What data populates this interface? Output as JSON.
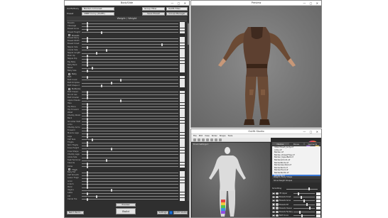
{
  "bodyslide": {
    "title": "BodySlide",
    "outfit_label": "Outfit/Body",
    "outfit_value": "Barden Armorset",
    "preset_label": "Preset",
    "preset_value": "CBBE Curvy (Outfit)",
    "group_filter": "Group Filter",
    "outfit_filter": "Outfit Filter",
    "save_preset": "Save Preset",
    "group_manager": "Group Manager",
    "header": "Weight / Weight",
    "categories": [
      {
        "label": "Breasts",
        "row": 4
      },
      {
        "label": "Belly",
        "row": 17
      },
      {
        "label": "Buttocks",
        "row": 22
      },
      {
        "label": "Thigh",
        "row": 49
      }
    ],
    "sliders": [
      {
        "name": "Breasts",
        "pos": 0.05
      },
      {
        "name": "Cleavage",
        "pos": 0.05
      },
      {
        "name": "Breast Gone",
        "pos": 0.05
      },
      {
        "name": "Breast Height",
        "pos": 0.2
      },
      {
        "name": "Breast Perky",
        "pos": 0.05
      },
      {
        "name": "Breast Width",
        "pos": 0.05
      },
      {
        "name": "Breast Small",
        "pos": 0.82
      },
      {
        "name": "Nipple Size",
        "pos": 0.05
      },
      {
        "name": "Areola Size",
        "pos": 0.25
      },
      {
        "name": "Nipple Length",
        "pos": 0.15
      },
      {
        "name": "Push Up",
        "pos": 0.05
      },
      {
        "name": "Nipple Dip",
        "pos": 0.05
      },
      {
        "name": "Big Belly",
        "pos": 0.05
      },
      {
        "name": "Belly Back",
        "pos": 0.05
      },
      {
        "name": "Navel",
        "pos": 0.1
      },
      {
        "name": "Belly Size",
        "pos": 0.05
      },
      {
        "name": "Butt",
        "pos": 0.05
      },
      {
        "name": "Butt Crack",
        "pos": 0.4
      },
      {
        "name": "Butt Dimples",
        "pos": 0.3
      },
      {
        "name": "Butt Shape 2",
        "pos": 0.2
      },
      {
        "name": "Butt Classic",
        "pos": 0.05
      },
      {
        "name": "Round Ass",
        "pos": 0.05
      },
      {
        "name": "Butt Smaller",
        "pos": 0.05
      },
      {
        "name": "Apple Cheeks",
        "pos": 0.4
      },
      {
        "name": "Hips",
        "pos": 0.05
      },
      {
        "name": "Hip Bone",
        "pos": 0.05
      },
      {
        "name": "Hip Forward",
        "pos": 0.05
      },
      {
        "name": "Waist",
        "pos": 0.05
      },
      {
        "name": "Chubby Waist",
        "pos": 0.05
      },
      {
        "name": "Back",
        "pos": 0.05
      },
      {
        "name": "Shoulder Width",
        "pos": 0.05
      },
      {
        "name": "Arms",
        "pos": 0.05
      },
      {
        "name": "Chubby Arms",
        "pos": 0.05
      },
      {
        "name": "Forearm",
        "pos": 0.05
      },
      {
        "name": "Muscle Legs",
        "pos": 0.05
      },
      {
        "name": "Legs",
        "pos": 0.05
      },
      {
        "name": "Calf Size",
        "pos": 0.1
      },
      {
        "name": "Thighs",
        "pos": 0.05
      },
      {
        "name": "Slim Thighs",
        "pos": 0.05
      },
      {
        "name": "Knee Height",
        "pos": 0.3
      },
      {
        "name": "Knee Shape",
        "pos": 0.05
      },
      {
        "name": "Chubby Legs",
        "pos": 0.05
      },
      {
        "name": "Ankle Size",
        "pos": 0.05
      },
      {
        "name": "Feet Feminine",
        "pos": 0.25
      },
      {
        "name": "Clavicle",
        "pos": 0.05
      },
      {
        "name": "Collar",
        "pos": 0.05
      },
      {
        "name": "Belly Fat",
        "pos": 0.05
      },
      {
        "name": "Calf Smooth",
        "pos": 0.05
      },
      {
        "name": "Lower Thigh",
        "pos": 0.05
      },
      {
        "name": "Groin",
        "pos": 0.05
      },
      {
        "name": "Crotch",
        "pos": 0.05
      },
      {
        "name": "Pubic",
        "pos": 0.05
      },
      {
        "name": "Vagina",
        "pos": 0.3
      },
      {
        "name": "Labia",
        "pos": 0.05
      },
      {
        "name": "Clit",
        "pos": 0.15
      },
      {
        "name": "Camel Toe",
        "pos": 0.05
      },
      {
        "name": "Upper Thigh",
        "pos": 0.05
      },
      {
        "name": "Knee Gap",
        "pos": 0.05
      }
    ],
    "preview_btn": "Preview",
    "build_btn": "Build",
    "batch_build": "Batch Build...",
    "settings_btn": "Settings",
    "outfit_studio_btn": "Outfit Studio"
  },
  "preview": {
    "title": "Preview"
  },
  "outfit_studio": {
    "title": "Outfit Studio",
    "menu": [
      "File",
      "Edit",
      "View",
      "Slider",
      "Shape",
      "Tools"
    ],
    "view_label": "Brush Settings ▾",
    "tabs": [
      "Meshes",
      "Bones",
      "Segments"
    ],
    "mesh_list": [
      "3DGirlHose5_body.nif",
      "Arms.nif",
      "Barden.nif",
      "Barden_DrawerFlag.nif",
      "Barden_UpperBelt.nif",
      "BardenArmorS.nif",
      "BardenBoots.nif",
      "BardenGauntlet.nif",
      "BardenSkirt.nif",
      "BardenHood.nif",
      "BardenSkirt2.nif"
    ],
    "selected_mesh": "BardenSkirt",
    "section_weight": "Weight / Body Shape",
    "show_weight": "Show Weight Shapes",
    "brush_label": "Smoothing",
    "os_sliders": [
      "7B Upper",
      "Breasts Small",
      "Breasts Gone",
      "Breasts SH",
      "Breasts Cleave",
      "Breasts Fantasy",
      "Butt Curve"
    ]
  }
}
